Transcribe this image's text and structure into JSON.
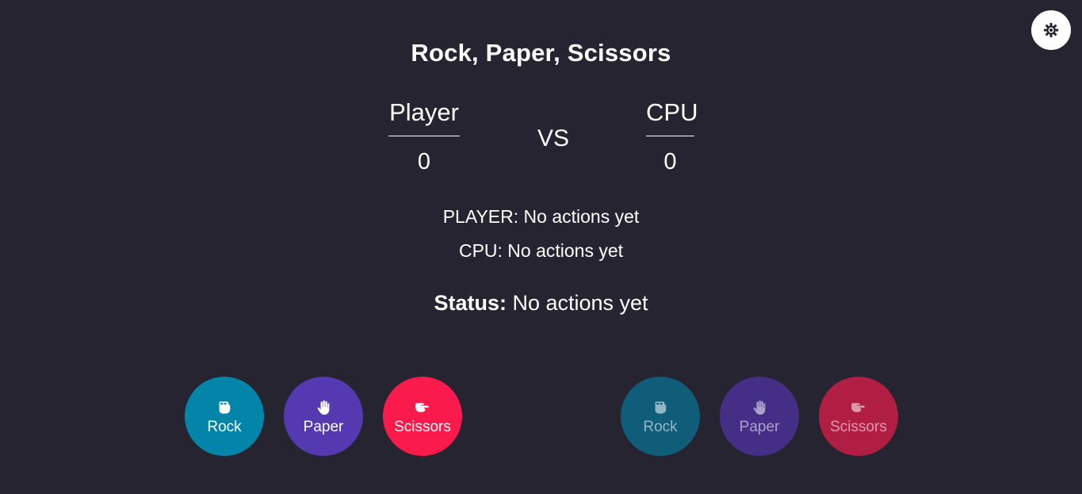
{
  "title": "Rock, Paper, Scissors",
  "theme_toggle": {
    "icon": "gear-icon"
  },
  "scoreboard": {
    "player": {
      "name": "Player",
      "score": "0"
    },
    "vs": "VS",
    "cpu": {
      "name": "CPU",
      "score": "0"
    }
  },
  "actions": {
    "player_line": "PLAYER: No actions yet",
    "cpu_line": "CPU: No actions yet"
  },
  "status": {
    "label": "Status:",
    "value": " No actions yet"
  },
  "player_buttons": [
    {
      "label": "Rock",
      "icon": "fist-icon",
      "color": "#0384a9"
    },
    {
      "label": "Paper",
      "icon": "hand-icon",
      "color": "#5539b0"
    },
    {
      "label": "Scissors",
      "icon": "scissors-hand-icon",
      "color": "#fa1a4b"
    }
  ],
  "cpu_buttons": [
    {
      "label": "Rock",
      "icon": "fist-icon",
      "color": "#0f5d79"
    },
    {
      "label": "Paper",
      "icon": "hand-icon",
      "color": "#452e86"
    },
    {
      "label": "Scissors",
      "icon": "scissors-hand-icon",
      "color": "#b11e43"
    }
  ],
  "colors": {
    "background": "#262430",
    "text": "#ffffff"
  }
}
